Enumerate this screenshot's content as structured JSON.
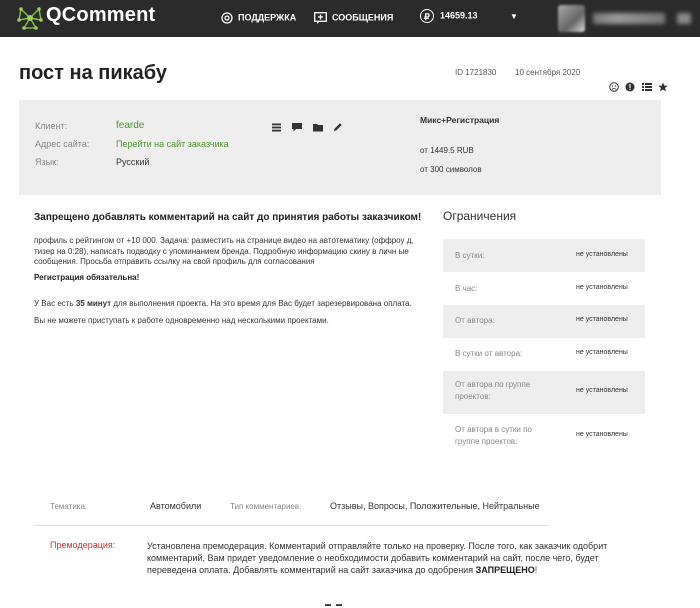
{
  "header": {
    "brand": "QComment",
    "nav": {
      "support": "ПОДДЕРЖКА",
      "messages": "СООБЩЕНИЯ"
    },
    "balance": "14659.13",
    "coin_symbol": "₽",
    "caret": "▼"
  },
  "order": {
    "title": "пост на пикабу",
    "id": "ID 1721830",
    "date": "10 сентября 2020"
  },
  "info": {
    "client_label": "Клиент:",
    "client_value": "fearde",
    "site_label": "Адрес сайта:",
    "site_value": "Перейти на сайт заказчика",
    "lang_label": "Язык:",
    "lang_value": "Русский",
    "package": "Микс+Регистрация",
    "price": "от 1449.5 RUB",
    "chars": "от 300 символов"
  },
  "task": {
    "warning": "Запрещено добавлять комментарий на сайт до принятия работы заказчиком!",
    "description": "профиль с рейтингом от +10 000. Задача: разместить на странице видео на автотематику (оффроу д, тизер на 0:28), написать подводку с упоминанием бренда. Подробную информацию скину в личн ые сообщения. Просьба отправить ссылку на свой профиль для согласования",
    "registration": "Регистрация обязательна!",
    "time_prefix": "У Вас есть ",
    "time_value": "35 минут",
    "time_suffix": " для выполнения проекта. На это время для Вас будет зарезервирована оплата.",
    "multi": "Вы не можете приступать к работе одновременно над несколькими проектами."
  },
  "restrictions": {
    "title": "Ограничения",
    "rows": [
      {
        "label": "В сутки:",
        "value": "не установлены"
      },
      {
        "label": "В час:",
        "value": "не установлены"
      },
      {
        "label": "От автора:",
        "value": "не установлены"
      },
      {
        "label": "В сутки от автора:",
        "value": "не установлены"
      },
      {
        "label": "От автора по группе проектов:",
        "value": "не установлены"
      },
      {
        "label": "От автора в сутки по группе проектов:",
        "value": "не установлены"
      }
    ]
  },
  "topic": {
    "label": "Тематика:",
    "value": "Автомобили",
    "type_label": "Тип комментариев:",
    "type_value": "Отзывы, Вопросы, Положительные, Нейтральные"
  },
  "premod": {
    "label": "Премодерация:",
    "text": "Установлена премодерация. Комментарий отправляйте только на проверку. После того, как заказчик одобрит комментарий, Вам придет уведомление о необходимости добавить комментарий на сайт, после чего, будет переведена оплата. Добавлять комментарий на сайт заказчика до одобрения ",
    "emphasis": "ЗАПРЕЩЕНО",
    "end": "!"
  },
  "colors": {
    "topbar": "#2b2b2b",
    "accent": "#4e9a2e",
    "danger": "#d32f2f",
    "panel": "#eeeeee"
  }
}
